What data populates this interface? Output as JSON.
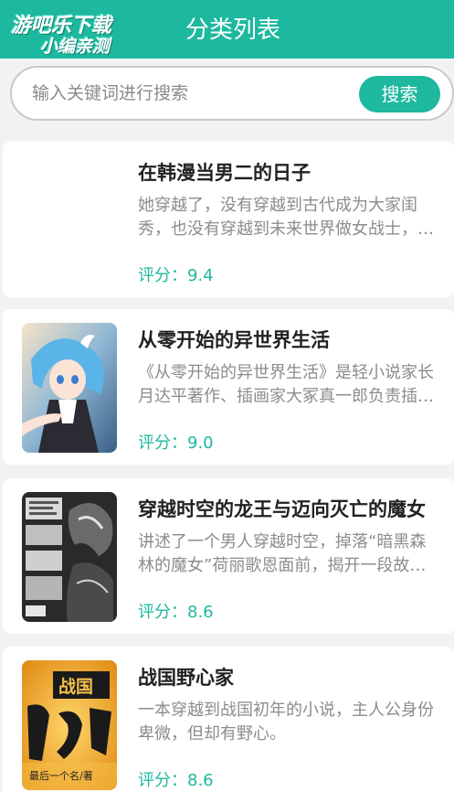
{
  "header": {
    "logo_line1": "游吧乐下载",
    "logo_line2": "小编亲测",
    "title": "分类列表"
  },
  "search": {
    "placeholder": "输入关键词进行搜索",
    "button_label": "搜索"
  },
  "rating_prefix": "评分：",
  "books": [
    {
      "title": "在韩漫当男二的日子",
      "description": "她穿越了，没有穿越到古代成为大家闺秀，也没有穿越到未来世界做女战士，而是穿越进了韩漫里。",
      "rating_text": "评分：9.4",
      "rating": 9.4,
      "has_cover": false
    },
    {
      "title": "从零开始的异世界生活",
      "description": "《从零开始的异世界生活》是轻小说家长月达平著作、插画家大冢真一郎负责插画的轻小说。",
      "rating_text": "评分：9.0",
      "rating": 9.0,
      "has_cover": true,
      "cover_colors": {
        "bg": "#6fa6c9",
        "hair": "#5ab4e8",
        "dress": "#2b2b33"
      }
    },
    {
      "title": "穿越时空的龙王与迈向灭亡的魔女",
      "description": "讲述了一个男人穿越时空，掉落“暗黑森林的魔女”荷丽歌恩面前，揭开一段故事。",
      "rating_text": "评分：8.6",
      "rating": 8.6,
      "has_cover": true,
      "cover_colors": {
        "bg": "#2a2a2a",
        "panel": "#d9d9d9"
      }
    },
    {
      "title": "战国野心家",
      "description": "一本穿越到战国初年的小说，主人公身份卑微，但却有野心。",
      "rating_text": "评分：8.6",
      "rating": 8.6,
      "has_cover": true,
      "cover_title": "战国",
      "cover_subtitle": "最后一个名/著",
      "cover_colors": {
        "bg": "#f2a81d",
        "ink": "#1a1a1a"
      }
    }
  ],
  "colors": {
    "accent": "#1db89e",
    "background": "#f2f2f2",
    "card": "#ffffff",
    "title_text": "#222222",
    "desc_text": "#8c8c8c"
  }
}
